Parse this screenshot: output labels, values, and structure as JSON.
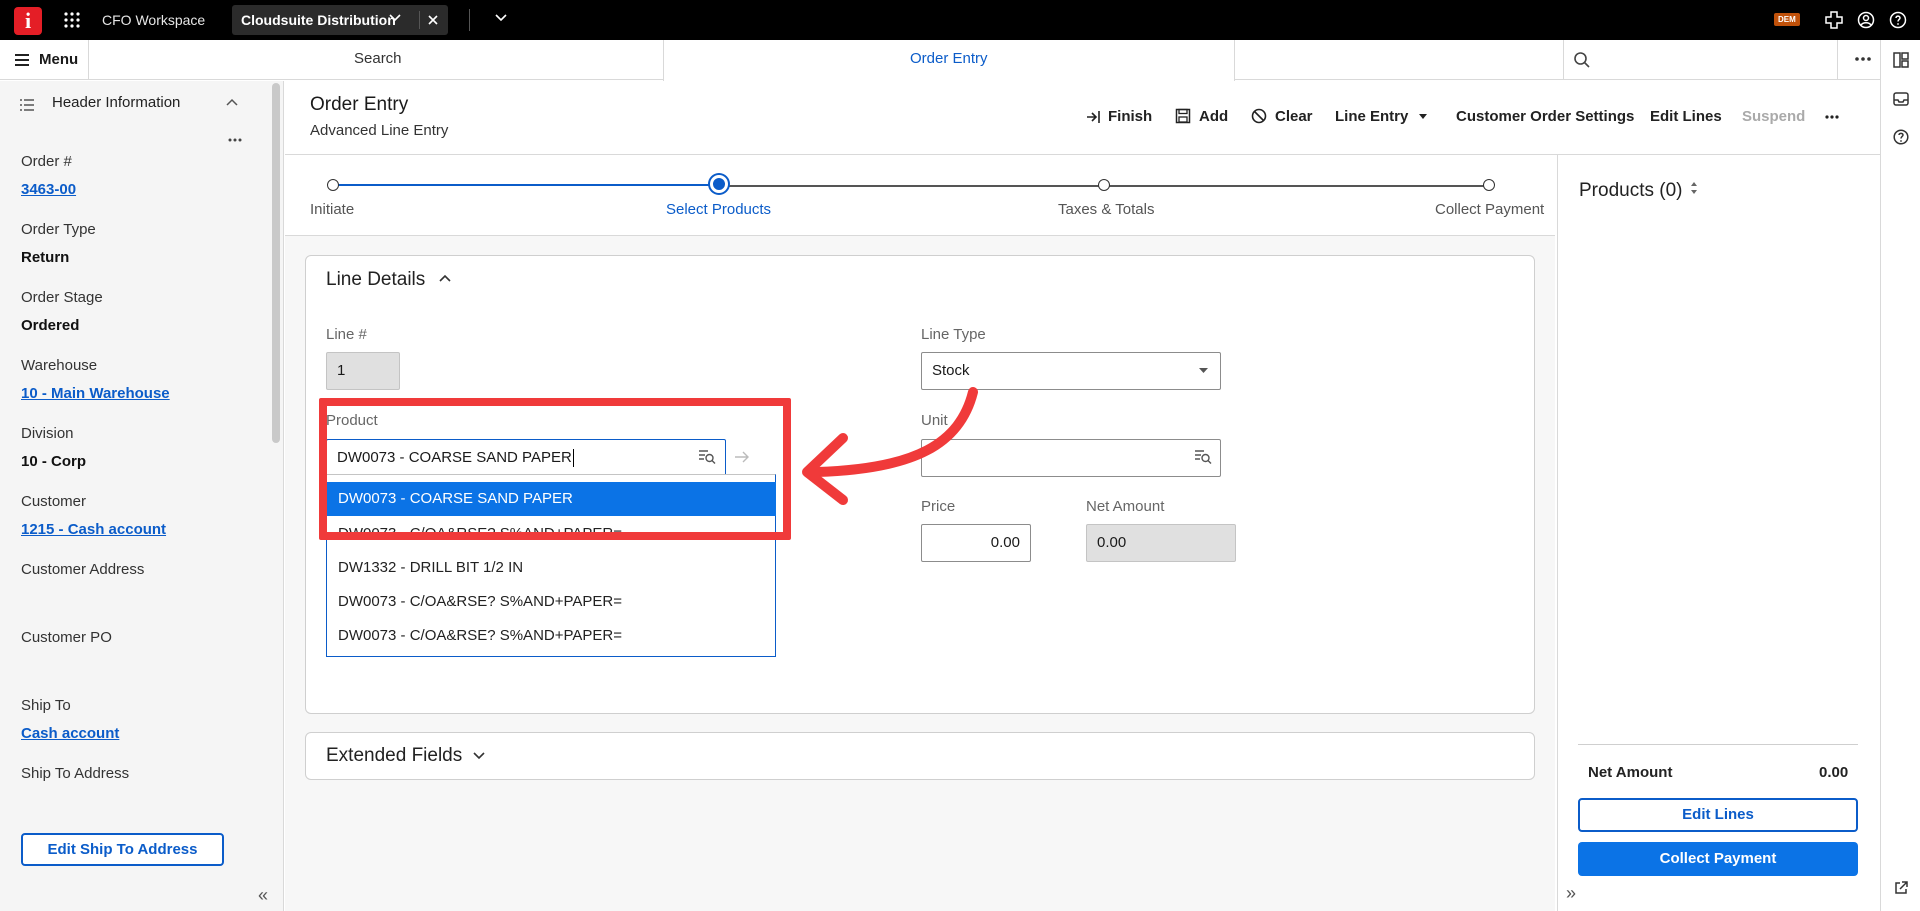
{
  "topbar": {
    "logo_text": "i",
    "workspace": "CFO Workspace",
    "app_tab": "Cloudsuite Distribution",
    "badge": "DEM"
  },
  "navbar": {
    "menu_label": "Menu",
    "search_tab": "Search",
    "order_tab": "Order Entry"
  },
  "left_panel": {
    "title": "Header Information",
    "fields": [
      {
        "label": "Order #",
        "value": "3463-00",
        "link": true
      },
      {
        "label": "Order Type",
        "value": "Return",
        "link": false
      },
      {
        "label": "Order Stage",
        "value": "Ordered",
        "link": false
      },
      {
        "label": "Warehouse",
        "value": "10 - Main Warehouse",
        "link": true
      },
      {
        "label": "Division",
        "value": "10 - Corp",
        "link": false
      },
      {
        "label": "Customer",
        "value": "1215 - Cash account",
        "link": true
      },
      {
        "label": "Customer Address",
        "value": "",
        "link": false
      },
      {
        "label": "Customer PO",
        "value": "",
        "link": false
      },
      {
        "label": "Ship To",
        "value": "Cash account",
        "link": true
      },
      {
        "label": "Ship To Address",
        "value": "",
        "link": false
      }
    ],
    "edit_button": "Edit Ship To Address"
  },
  "header": {
    "title": "Order Entry",
    "subtitle": "Advanced Line Entry",
    "toolbar": {
      "finish": "Finish",
      "add": "Add",
      "clear": "Clear",
      "line_entry": "Line Entry",
      "customer_order_settings": "Customer Order Settings",
      "edit_lines": "Edit Lines",
      "suspend": "Suspend"
    }
  },
  "stepper": {
    "steps": [
      "Initiate",
      "Select Products",
      "Taxes & Totals",
      "Collect Payment"
    ],
    "active_index": 1
  },
  "line_details": {
    "title": "Line Details",
    "line_no_label": "Line #",
    "line_no_value": "1",
    "line_type_label": "Line Type",
    "line_type_value": "Stock",
    "product_label": "Product",
    "product_value": "DW0073 - COARSE SAND PAPER",
    "unit_label": "Unit",
    "unit_value": "",
    "price_label": "Price",
    "price_value": "0.00",
    "net_amount_label": "Net Amount",
    "net_amount_value": "0.00",
    "suggestions": [
      "DW0073 - COARSE SAND PAPER",
      "DW0073 - C/OA&RSE? S%AND+PAPER=",
      "DW1332 - DRILL BIT 1/2 IN",
      "DW0073 - C/OA&RSE? S%AND+PAPER=",
      "DW0073 - C/OA&RSE? S%AND+PAPER="
    ],
    "selected_suggestion": 0
  },
  "extended_fields": {
    "title": "Extended Fields"
  },
  "right_panel": {
    "title": "Products (0)",
    "net_amount_label": "Net Amount",
    "net_amount_value": "0.00",
    "edit_lines": "Edit Lines",
    "collect_payment": "Collect Payment"
  },
  "colors": {
    "accent": "#0b73e6",
    "link": "#0b5cc9",
    "annotation": "#f03a3a",
    "brand": "#e41e26"
  }
}
